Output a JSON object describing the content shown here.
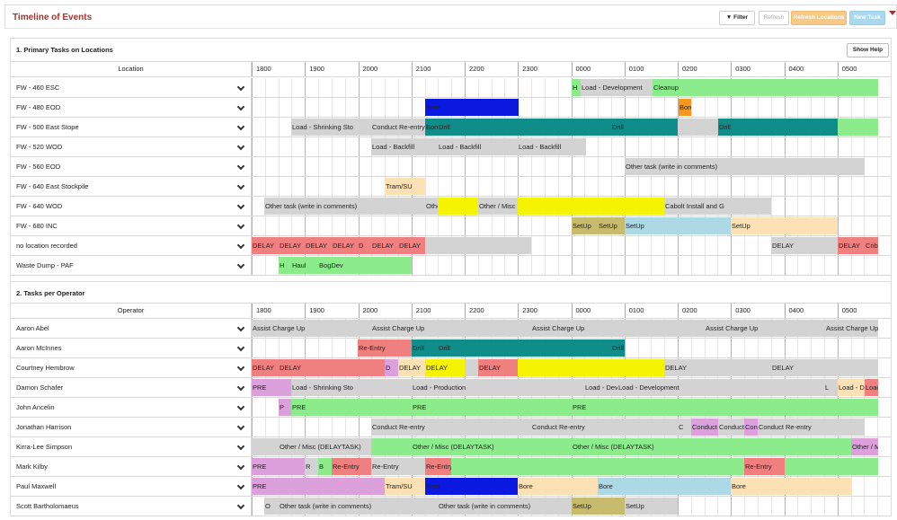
{
  "header": {
    "title": "Timeline of Events",
    "filter_label": "Filter",
    "refresh_label": "Refresh",
    "refresh_locations_label": "Refresh Locations",
    "new_task_label": "New Task"
  },
  "colors": {
    "title": "#a8322d",
    "gray": "#d3d3d3",
    "green": "#8cec8c",
    "blue": "#0a18e0",
    "teal": "#0f8d8a",
    "orange": "#f7981d",
    "yellow": "#f6f300",
    "red": "#f08080",
    "peach": "#fbe1b3",
    "lightblue": "#add8e6",
    "olive": "#c7bb6d",
    "pink": "#dca0dc"
  },
  "hours": [
    "1800",
    "1900",
    "2000",
    "2100",
    "2200",
    "2300",
    "0000",
    "0100",
    "0200",
    "0300",
    "0400",
    "0500"
  ],
  "sections": [
    {
      "title": "1. Primary Tasks on Locations",
      "show_help_label": "Show Help",
      "column_label": "Location",
      "rows": [
        {
          "label": "FW - 460 ESC",
          "bars": [
            {
              "s": 356,
              "e": 366,
              "c": "green",
              "t": "H"
            },
            {
              "s": 366,
              "e": 446,
              "c": "gray",
              "t": "Load - Development"
            },
            {
              "s": 446,
              "e": 697,
              "c": "green",
              "t": "Cleanup"
            }
          ]
        },
        {
          "label": "FW - 480 EOD",
          "bars": [
            {
              "s": 193,
              "e": 297,
              "c": "blue",
              "t": "Bore"
            },
            {
              "s": 475,
              "e": 489,
              "c": "orange",
              "t": "Bore"
            }
          ]
        },
        {
          "label": "FW - 500 East Stope",
          "bars": [
            {
              "s": 44,
              "e": 133,
              "c": "gray",
              "t": "Load - Shrinking Sto"
            },
            {
              "s": 133,
              "e": 193,
              "c": "gray",
              "t": "Conduct Re-entry"
            },
            {
              "s": 193,
              "e": 207,
              "c": "teal",
              "t": "Bore"
            },
            {
              "s": 207,
              "e": 400,
              "c": "teal",
              "t": "Drill"
            },
            {
              "s": 400,
              "e": 474,
              "c": "teal",
              "t": "Drill"
            },
            {
              "s": 474,
              "e": 519,
              "c": "gray",
              "t": ""
            },
            {
              "s": 519,
              "e": 652,
              "c": "teal",
              "t": "Drill"
            },
            {
              "s": 652,
              "e": 697,
              "c": "green",
              "t": ""
            }
          ]
        },
        {
          "label": "FW - 520 WOD",
          "bars": [
            {
              "s": 133,
              "e": 207,
              "c": "gray",
              "t": "Load - Backfill"
            },
            {
              "s": 207,
              "e": 296,
              "c": "gray",
              "t": "Load - Backfill"
            },
            {
              "s": 296,
              "e": 372,
              "c": "gray",
              "t": "Load - Backfill"
            }
          ]
        },
        {
          "label": "FW - 560 EOD",
          "bars": [
            {
              "s": 415,
              "e": 682,
              "c": "gray",
              "t": "Other task (write in comments)"
            }
          ]
        },
        {
          "label": "FW - 640 East Stockpile",
          "bars": [
            {
              "s": 148,
              "e": 193,
              "c": "peach",
              "t": "Tram/SU"
            }
          ]
        },
        {
          "label": "FW - 640 WOD",
          "bars": [
            {
              "s": 14,
              "e": 193,
              "c": "gray",
              "t": "Other task (write in comments)"
            },
            {
              "s": 193,
              "e": 207,
              "c": "gray",
              "t": "Other task (write in comments)"
            },
            {
              "s": 207,
              "e": 252,
              "c": "yellow",
              "t": ""
            },
            {
              "s": 252,
              "e": 296,
              "c": "gray",
              "t": "Other / Misc (DELAYTASK)"
            },
            {
              "s": 296,
              "e": 459,
              "c": "yellow",
              "t": ""
            },
            {
              "s": 459,
              "e": 578,
              "c": "gray",
              "t": "Cabolt Install and G"
            }
          ]
        },
        {
          "label": "FW - 680 INC",
          "bars": [
            {
              "s": 356,
              "e": 385,
              "c": "olive",
              "t": "SetUp"
            },
            {
              "s": 385,
              "e": 415,
              "c": "olive",
              "t": "SetUp"
            },
            {
              "s": 415,
              "e": 533,
              "c": "lightblue",
              "t": "SetUp"
            },
            {
              "s": 533,
              "e": 652,
              "c": "peach",
              "t": "SetUp"
            }
          ]
        },
        {
          "label": "no location recorded",
          "bars": [
            {
              "s": 0,
              "e": 30,
              "c": "red",
              "t": "DELAY"
            },
            {
              "s": 30,
              "e": 59,
              "c": "red",
              "t": "DELAY"
            },
            {
              "s": 59,
              "e": 89,
              "c": "red",
              "t": "DELAY"
            },
            {
              "s": 89,
              "e": 118,
              "c": "red",
              "t": "DELAY"
            },
            {
              "s": 118,
              "e": 133,
              "c": "red",
              "t": "D"
            },
            {
              "s": 133,
              "e": 163,
              "c": "red",
              "t": "DELAY"
            },
            {
              "s": 163,
              "e": 193,
              "c": "red",
              "t": "DELAY"
            },
            {
              "s": 193,
              "e": 311,
              "c": "gray",
              "t": ""
            },
            {
              "s": 578,
              "e": 652,
              "c": "gray",
              "t": "DELAY"
            },
            {
              "s": 652,
              "e": 682,
              "c": "red",
              "t": "DELAY"
            },
            {
              "s": 682,
              "e": 697,
              "c": "red",
              "t": "Crib"
            }
          ]
        },
        {
          "label": "Waste Dump - PAF",
          "bars": [
            {
              "s": 30,
              "e": 44,
              "c": "green",
              "t": "H"
            },
            {
              "s": 44,
              "e": 74,
              "c": "green",
              "t": "Haul"
            },
            {
              "s": 74,
              "e": 178,
              "c": "green",
              "t": "BogDev"
            }
          ]
        }
      ]
    },
    {
      "title": "2. Tasks per Operator",
      "show_help_label": "",
      "column_label": "Operator",
      "rows": [
        {
          "label": "Aaron Abel",
          "bars": [
            {
              "s": 0,
              "e": 133,
              "c": "gray",
              "t": "Assist Charge Up"
            },
            {
              "s": 133,
              "e": 311,
              "c": "gray",
              "t": "Assist Charge Up"
            },
            {
              "s": 311,
              "e": 504,
              "c": "gray",
              "t": "Assist Charge Up"
            },
            {
              "s": 504,
              "e": 638,
              "c": "gray",
              "t": "Assist Charge Up"
            },
            {
              "s": 638,
              "e": 697,
              "c": "gray",
              "t": "Assist Charge Up"
            }
          ]
        },
        {
          "label": "Aaron McInnes",
          "bars": [
            {
              "s": 118,
              "e": 178,
              "c": "red",
              "t": "Re-Entry"
            },
            {
              "s": 178,
              "e": 207,
              "c": "teal",
              "t": "Drill"
            },
            {
              "s": 207,
              "e": 400,
              "c": "teal",
              "t": "Drill"
            },
            {
              "s": 400,
              "e": 415,
              "c": "teal",
              "t": "Drill"
            }
          ]
        },
        {
          "label": "Courtney Hembrow",
          "bars": [
            {
              "s": 0,
              "e": 30,
              "c": "red",
              "t": "DELAY"
            },
            {
              "s": 30,
              "e": 148,
              "c": "red",
              "t": "DELAY"
            },
            {
              "s": 148,
              "e": 163,
              "c": "pink",
              "t": "D"
            },
            {
              "s": 163,
              "e": 193,
              "c": "peach",
              "t": "DELAY"
            },
            {
              "s": 193,
              "e": 237,
              "c": "yellow",
              "t": "DELAY"
            },
            {
              "s": 237,
              "e": 252,
              "c": "gray",
              "t": ""
            },
            {
              "s": 252,
              "e": 296,
              "c": "red",
              "t": "DELAY"
            },
            {
              "s": 296,
              "e": 459,
              "c": "yellow",
              "t": ""
            },
            {
              "s": 459,
              "e": 578,
              "c": "gray",
              "t": "DELAY"
            },
            {
              "s": 578,
              "e": 697,
              "c": "gray",
              "t": "DELAY"
            }
          ]
        },
        {
          "label": "Damon Schafer",
          "bars": [
            {
              "s": 0,
              "e": 30,
              "c": "pink",
              "t": "PRE"
            },
            {
              "s": 30,
              "e": 44,
              "c": "pink",
              "t": ""
            },
            {
              "s": 44,
              "e": 178,
              "c": "gray",
              "t": "Load - Shrinking Sto"
            },
            {
              "s": 178,
              "e": 370,
              "c": "gray",
              "t": "Load - Production"
            },
            {
              "s": 370,
              "e": 407,
              "c": "gray",
              "t": "Load - Development"
            },
            {
              "s": 407,
              "e": 637,
              "c": "gray",
              "t": "Load - Development"
            },
            {
              "s": 637,
              "e": 652,
              "c": "gray",
              "t": "L"
            },
            {
              "s": 652,
              "e": 682,
              "c": "peach",
              "t": "Load - Development"
            },
            {
              "s": 682,
              "e": 697,
              "c": "red",
              "t": "Load - Development"
            }
          ]
        },
        {
          "label": "John Ancelin",
          "bars": [
            {
              "s": 30,
              "e": 44,
              "c": "pink",
              "t": "P"
            },
            {
              "s": 44,
              "e": 178,
              "c": "green",
              "t": "PRE"
            },
            {
              "s": 178,
              "e": 356,
              "c": "green",
              "t": "PRE"
            },
            {
              "s": 356,
              "e": 697,
              "c": "green",
              "t": "PRE"
            }
          ]
        },
        {
          "label": "Jonathan Harrison",
          "bars": [
            {
              "s": 133,
              "e": 311,
              "c": "gray",
              "t": "Conduct Re-entry"
            },
            {
              "s": 311,
              "e": 474,
              "c": "gray",
              "t": "Conduct Re-entry"
            },
            {
              "s": 474,
              "e": 489,
              "c": "gray",
              "t": "C"
            },
            {
              "s": 489,
              "e": 519,
              "c": "pink",
              "t": "Conduct Re-entry"
            },
            {
              "s": 519,
              "e": 548,
              "c": "gray",
              "t": "Conduct Re-entry"
            },
            {
              "s": 548,
              "e": 563,
              "c": "pink",
              "t": "Conduct Re-entry"
            },
            {
              "s": 563,
              "e": 682,
              "c": "gray",
              "t": "Conduct Re-entry"
            }
          ]
        },
        {
          "label": "Kirra-Lee Simpson",
          "bars": [
            {
              "s": 0,
              "e": 30,
              "c": "gray",
              "t": ""
            },
            {
              "s": 30,
              "e": 133,
              "c": "gray",
              "t": "Other / Misc (DELAYTASK)"
            },
            {
              "s": 133,
              "e": 178,
              "c": "green",
              "t": ""
            },
            {
              "s": 178,
              "e": 356,
              "c": "green",
              "t": "Other / Misc (DELAYTASK)"
            },
            {
              "s": 356,
              "e": 667,
              "c": "green",
              "t": "Other / Misc (DELAYTASK)"
            },
            {
              "s": 667,
              "e": 697,
              "c": "pink",
              "t": "Other / Misc (DELAYTASK)"
            }
          ]
        },
        {
          "label": "Mark Kilby",
          "bars": [
            {
              "s": 0,
              "e": 59,
              "c": "pink",
              "t": "PRE"
            },
            {
              "s": 59,
              "e": 74,
              "c": "gray",
              "t": "R"
            },
            {
              "s": 74,
              "e": 89,
              "c": "green",
              "t": "B"
            },
            {
              "s": 89,
              "e": 133,
              "c": "red",
              "t": "Re-Entry"
            },
            {
              "s": 133,
              "e": 193,
              "c": "gray",
              "t": "Re-Entry"
            },
            {
              "s": 193,
              "e": 222,
              "c": "red",
              "t": "Re-Entry"
            },
            {
              "s": 222,
              "e": 548,
              "c": "green",
              "t": ""
            },
            {
              "s": 548,
              "e": 593,
              "c": "red",
              "t": "Re-Entry"
            },
            {
              "s": 593,
              "e": 697,
              "c": "green",
              "t": ""
            }
          ]
        },
        {
          "label": "Paul Maxwell",
          "bars": [
            {
              "s": 0,
              "e": 30,
              "c": "pink",
              "t": "PRE"
            },
            {
              "s": 30,
              "e": 148,
              "c": "pink",
              "t": ""
            },
            {
              "s": 148,
              "e": 193,
              "c": "peach",
              "t": "Tram/SU"
            },
            {
              "s": 193,
              "e": 296,
              "c": "blue",
              "t": "Bore"
            },
            {
              "s": 296,
              "e": 385,
              "c": "peach",
              "t": "Bore"
            },
            {
              "s": 385,
              "e": 533,
              "c": "lightblue",
              "t": "Bore"
            },
            {
              "s": 533,
              "e": 667,
              "c": "peach",
              "t": "Bore"
            }
          ]
        },
        {
          "label": "Scott Bartholomaeus",
          "bars": [
            {
              "s": 14,
              "e": 30,
              "c": "gray",
              "t": "O"
            },
            {
              "s": 30,
              "e": 207,
              "c": "gray",
              "t": "Other task (write in comments)"
            },
            {
              "s": 207,
              "e": 356,
              "c": "gray",
              "t": "Other task (write in comments)"
            },
            {
              "s": 356,
              "e": 415,
              "c": "olive",
              "t": "SetUp"
            },
            {
              "s": 415,
              "e": 474,
              "c": "gray",
              "t": "SetUp"
            }
          ]
        }
      ]
    }
  ]
}
